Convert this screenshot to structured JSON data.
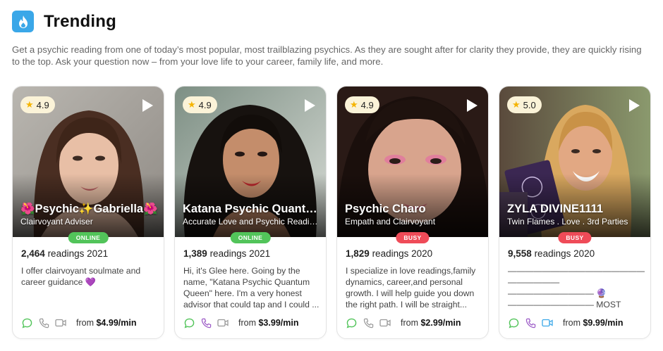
{
  "header": {
    "title": "Trending",
    "logo_icon": "flame-icon",
    "logo_color": "#3aa7e8"
  },
  "intro": "Get a psychic reading from one of today’s most popular, most trailblazing psychics. As they are sought after for clarity they provide, they are quickly rising to the top. Ask your question now – from your love life to your career, family life, and more.",
  "colors": {
    "online": "#52c45a",
    "busy": "#ef4b58",
    "star": "#f5b400",
    "chat_icon": "#52c45a",
    "active_icon": "#9b59c6",
    "video_active": "#3aa7e8"
  },
  "cards": [
    {
      "rating": "4.9",
      "name": "🌺Psychic✨Gabriella🌺",
      "role": "Clairvoyant Adviser",
      "status": "ONLINE",
      "readings_count": "2,464",
      "readings_suffix": "readings 2021",
      "description": "I offer clairvoyant soulmate and career guidance 💜",
      "price_prefix": "from",
      "price": "$4.99/min",
      "icons": [
        "chat-icon",
        "phone-icon",
        "video-icon"
      ]
    },
    {
      "rating": "4.9",
      "name": "Katana Psychic Quantum Queen",
      "role": "Accurate Love and Psychic Readings",
      "status": "ONLINE",
      "readings_count": "1,389",
      "readings_suffix": "readings 2021",
      "description": "Hi, it's Glee here. Going by the name, \"Katana Psychic Quantum Queen\" here. I'm a very honest advisor that could tap and I could ...",
      "price_prefix": "from",
      "price": "$3.99/min",
      "icons": [
        "chat-icon",
        "phone-icon",
        "video-icon"
      ]
    },
    {
      "rating": "4.9",
      "name": "Psychic Charo",
      "role": "Empath and Clairvoyant",
      "status": "BUSY",
      "readings_count": "1,829",
      "readings_suffix": "readings 2020",
      "description": "I specialize in love readings,family dynamics, career,and personal growth. I will help guide you down the right path. I will be straight...",
      "price_prefix": "from",
      "price": "$2.99/min",
      "icons": [
        "chat-icon",
        "phone-icon",
        "video-icon"
      ]
    },
    {
      "rating": "5.0",
      "name": "ZYLA DIVINE1111",
      "role": "Twin Flames . Love . 3rd Parties",
      "status": "BUSY",
      "readings_count": "9,558",
      "readings_suffix": "readings 2020",
      "description": "—————————————————— —————— —————————— 🔮—————————— MOST RECOMMENDED ADVISOR: 💜💜💜💜",
      "price_prefix": "from",
      "price": "$9.99/min",
      "icons": [
        "chat-icon",
        "phone-icon",
        "video-icon"
      ]
    }
  ]
}
